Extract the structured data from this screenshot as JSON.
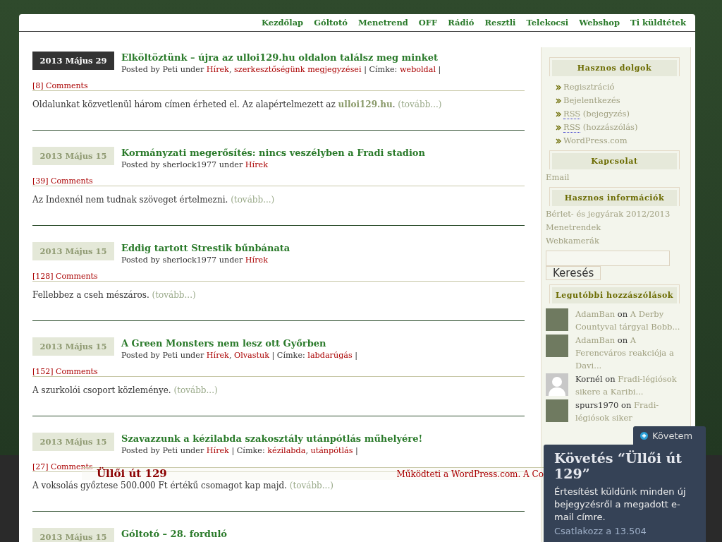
{
  "nav": {
    "items": [
      {
        "label": "Kezdőlap"
      },
      {
        "label": "Góltotó"
      },
      {
        "label": "Menetrend"
      },
      {
        "label": "OFF"
      },
      {
        "label": "Rádió"
      },
      {
        "label": "Resztli"
      },
      {
        "label": "Telekocsi"
      },
      {
        "label": "Webshop"
      },
      {
        "label": "Ti küldtétek"
      }
    ]
  },
  "posts": [
    {
      "date": "2013 Május 29",
      "featured": true,
      "title": "Elköltöztünk – újra az ulloi129.hu oldalon találsz meg minket",
      "meta": [
        {
          "kind": "plain",
          "text": "Posted by Peti under "
        },
        {
          "kind": "link",
          "text": "Hírek"
        },
        {
          "kind": "plain",
          "text": ", "
        },
        {
          "kind": "link",
          "text": "szerkesztőségünk megjegyzései"
        },
        {
          "kind": "plain",
          "text": " | Címke: "
        },
        {
          "kind": "link",
          "text": "weboldal"
        },
        {
          "kind": "plain",
          "text": " |"
        }
      ],
      "comments": "[8] Comments",
      "excerpt": [
        {
          "kind": "plain",
          "text": "Oldalunkat közvetlenül három címen érheted el. Az alapértelmezett az "
        },
        {
          "kind": "strong",
          "text": "ulloi129.hu"
        },
        {
          "kind": "plain",
          "text": ". "
        },
        {
          "kind": "more",
          "text": "(tovább...)"
        }
      ]
    },
    {
      "date": "2013 Május 15",
      "featured": false,
      "title": "Kormányzati megerősítés: nincs veszélyben a Fradi stadion",
      "meta": [
        {
          "kind": "plain",
          "text": "Posted by sherlock1977 under "
        },
        {
          "kind": "link",
          "text": "Hírek"
        }
      ],
      "comments": "[39] Comments",
      "excerpt": [
        {
          "kind": "plain",
          "text": "Az Indexnél nem tudnak szöveget értelmezni. "
        },
        {
          "kind": "more",
          "text": "(tovább...)"
        }
      ]
    },
    {
      "date": "2013 Május 15",
      "featured": false,
      "title": "Eddig tartott Strestik bűnbánata",
      "meta": [
        {
          "kind": "plain",
          "text": "Posted by sherlock1977 under "
        },
        {
          "kind": "link",
          "text": "Hírek"
        }
      ],
      "comments": "[128] Comments",
      "excerpt": [
        {
          "kind": "plain",
          "text": "Fellebbez a cseh mészáros. "
        },
        {
          "kind": "more",
          "text": "(tovább...)"
        }
      ]
    },
    {
      "date": "2013 Május 15",
      "featured": false,
      "title": "A Green Monsters nem lesz ott Győrben",
      "meta": [
        {
          "kind": "plain",
          "text": "Posted by Peti under "
        },
        {
          "kind": "link",
          "text": "Hírek"
        },
        {
          "kind": "plain",
          "text": ", "
        },
        {
          "kind": "link",
          "text": "Olvastuk"
        },
        {
          "kind": "plain",
          "text": " | Címke: "
        },
        {
          "kind": "link",
          "text": "labdarúgás"
        },
        {
          "kind": "plain",
          "text": " |"
        }
      ],
      "comments": "[152] Comments",
      "excerpt": [
        {
          "kind": "plain",
          "text": "A szurkolói csoport közleménye. "
        },
        {
          "kind": "more",
          "text": "(tovább...)"
        }
      ]
    },
    {
      "date": "2013 Május 15",
      "featured": false,
      "title": "Szavazzunk a kézilabda szakosztály utánpótlás műhelyére!",
      "meta": [
        {
          "kind": "plain",
          "text": "Posted by Peti under "
        },
        {
          "kind": "link",
          "text": "Hírek"
        },
        {
          "kind": "plain",
          "text": " | Címke: "
        },
        {
          "kind": "link",
          "text": "kézilabda"
        },
        {
          "kind": "plain",
          "text": ", "
        },
        {
          "kind": "link",
          "text": "utánpótlás"
        },
        {
          "kind": "plain",
          "text": " |"
        }
      ],
      "comments": "[27] Comments",
      "excerpt": [
        {
          "kind": "plain",
          "text": "A voksolás győztese 500.000 Ft értékű csomagot kap majd. "
        },
        {
          "kind": "more",
          "text": "(tovább...)"
        }
      ]
    },
    {
      "date": "2013 Május 15",
      "featured": false,
      "title": "Góltotó – 28. forduló"
    }
  ],
  "sidebar": {
    "widgets": [
      {
        "kind": "links",
        "title": "Hasznos dolgok",
        "items": [
          {
            "text": "Regisztráció"
          },
          {
            "text": "Bejelentkezés"
          },
          {
            "abbr": "RSS",
            "text": " (bejegyzés)"
          },
          {
            "abbr": "RSS",
            "text": " (hozzászólás)"
          },
          {
            "text": "WordPress.com"
          }
        ]
      },
      {
        "kind": "plain",
        "title": "Kapcsolat",
        "items": [
          {
            "text": "Email"
          }
        ]
      },
      {
        "kind": "plain",
        "title": "Hasznos információk",
        "items": [
          {
            "text": "Bérlet- és jegyárak 2012/2013"
          },
          {
            "text": "Menetrendek"
          },
          {
            "text": "Webkamerák"
          }
        ]
      },
      {
        "kind": "search",
        "button": "Keresés"
      },
      {
        "kind": "comments",
        "title": "Legutóbbi hozzászólások",
        "items": [
          {
            "kind": "photo",
            "author": "AdamBan",
            "author_link": true,
            "on": " on ",
            "post": "A Derby Countyval tárgyal Bobb..."
          },
          {
            "kind": "photo",
            "author": "AdamBan",
            "author_link": true,
            "on": " on ",
            "post": "A Ferencváros reakciója a Davi..."
          },
          {
            "kind": "silhouette",
            "author": "Kornél",
            "author_link": false,
            "on": " on ",
            "post": "Fradi-légiósok sikere a Karibi..."
          },
          {
            "kind": "photo",
            "author": "spurs1970",
            "author_link": false,
            "on": " on ",
            "post": "Fradi-légiósok siker"
          }
        ]
      }
    ]
  },
  "footer": {
    "site": "Üllői út 129",
    "credit": "Működteti a WordPress.com. A Co"
  },
  "follow": {
    "button": "Követem",
    "title": "Követés “Üllői út 129”",
    "text": "Értesítést küldünk minden új bejegyzésről a megadott e-mail címre.",
    "join": "Csatlakozz a 13.504"
  }
}
